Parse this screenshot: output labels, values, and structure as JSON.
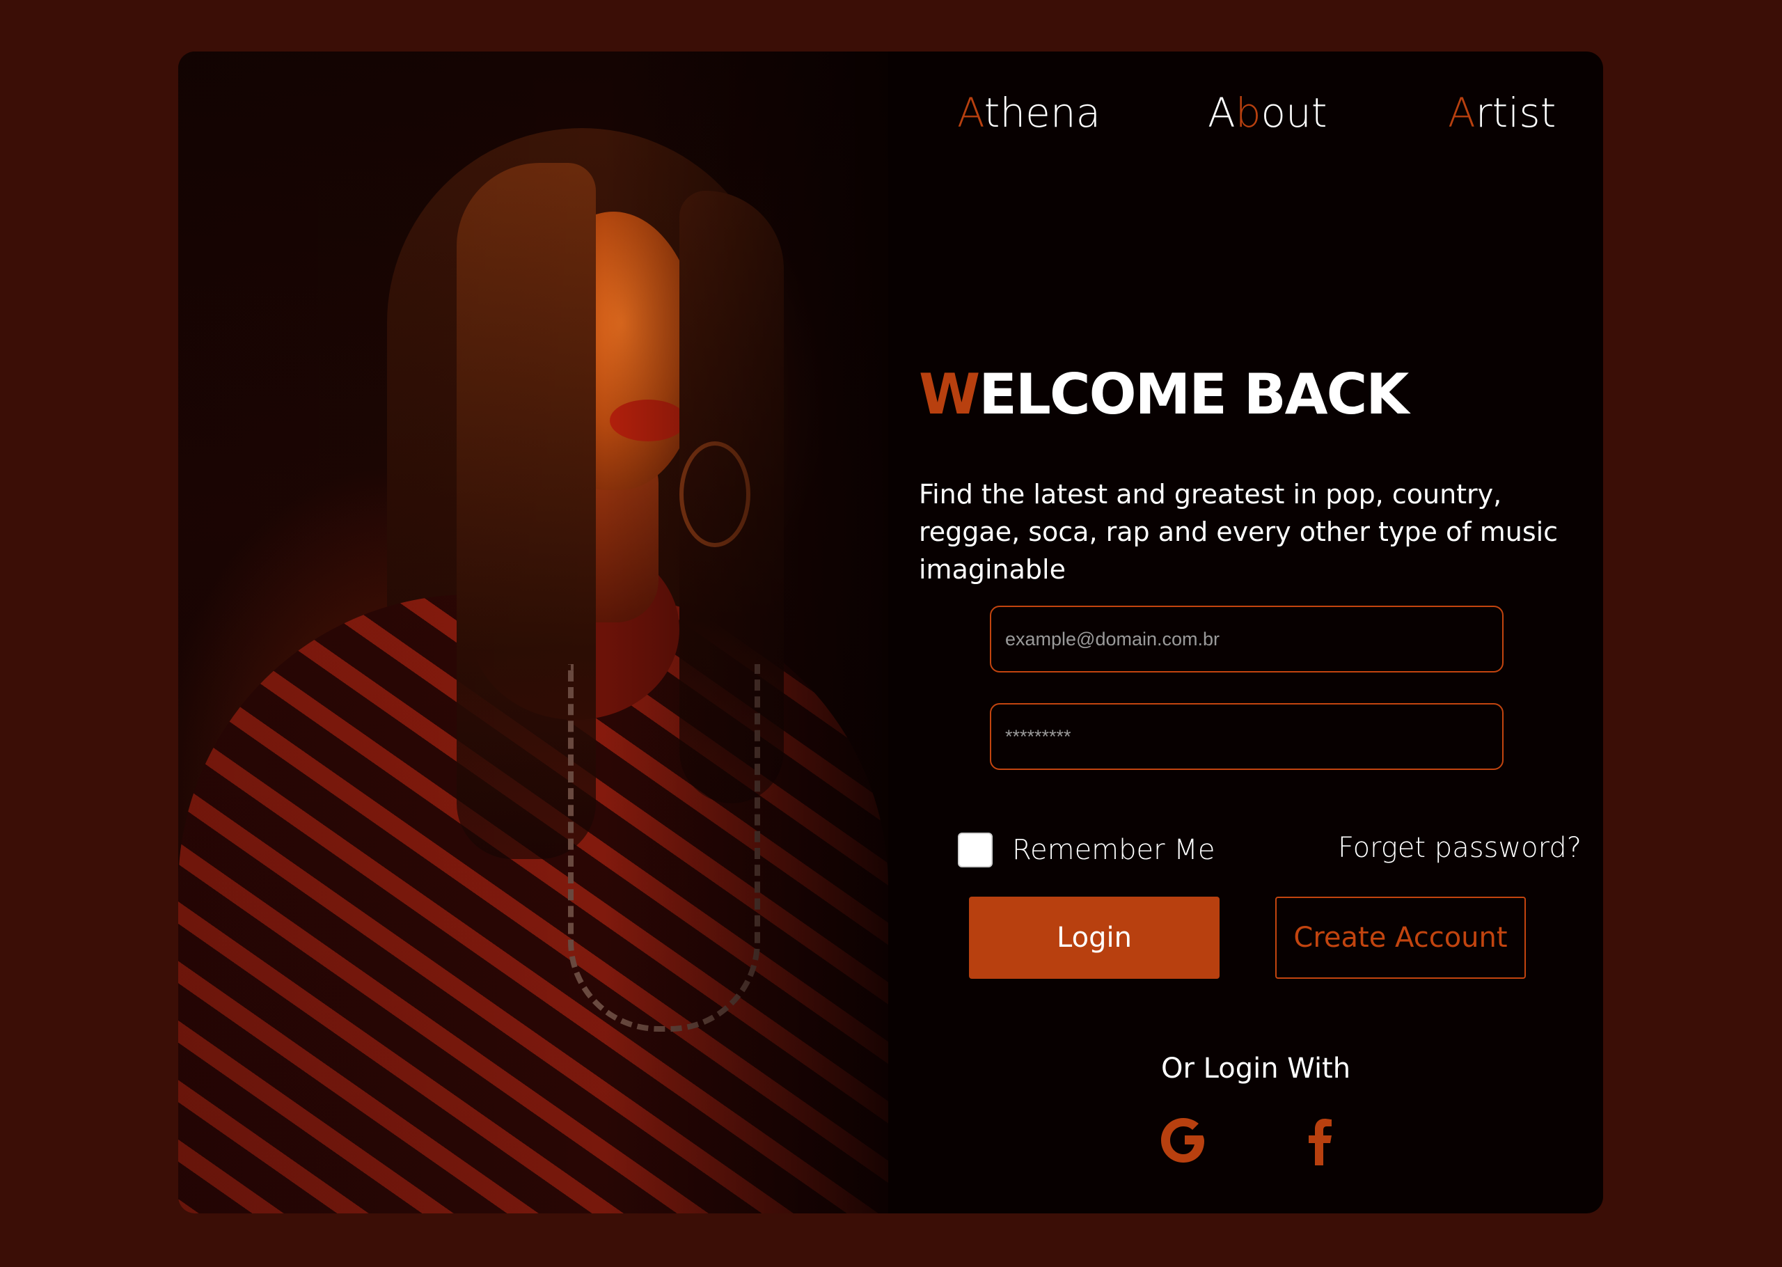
{
  "nav": {
    "items": [
      {
        "accent": "A",
        "rest": "thena"
      },
      {
        "lead": "A",
        "accent": "b",
        "rest": "out"
      },
      {
        "accent": "A",
        "rest": "rtist"
      }
    ]
  },
  "hero": {
    "title_accent": "W",
    "title_rest": "ELCOME BACK",
    "tagline": "Find the latest and greatest in pop, country, reggae, soca, rap and every other type of music imaginable"
  },
  "form": {
    "email_placeholder": "example@domain.com.br",
    "password_placeholder": "*********",
    "remember_label": "Remember Me",
    "remember_checked": false,
    "forget_label": "Forget password?",
    "login_label": "Login",
    "create_label": "Create Account"
  },
  "social": {
    "label": "Or Login With",
    "providers": [
      "google-icon",
      "facebook-icon"
    ]
  },
  "colors": {
    "page_background": "#3b0e06",
    "card_background": "#070000",
    "accent": "#b8400f",
    "text": "#ffffff"
  }
}
